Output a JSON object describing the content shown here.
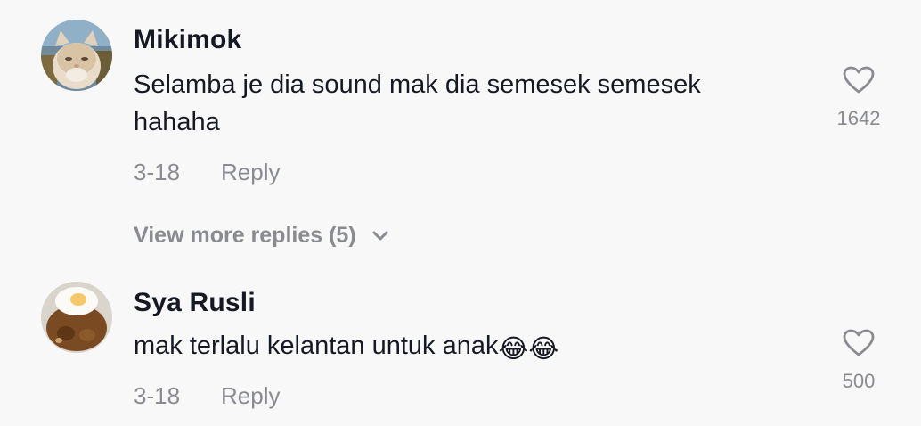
{
  "comments": [
    {
      "username": "Mikimok",
      "text": "Selamba je dia sound mak dia semesek semesek hahaha",
      "date": "3-18",
      "reply_label": "Reply",
      "likes": "1642",
      "avatar_icon": "cat-avatar"
    },
    {
      "username": "Sya Rusli",
      "text": "mak terlalu kelantan untuk anak",
      "emojis": "😂😂",
      "date": "3-18",
      "reply_label": "Reply",
      "likes": "500",
      "avatar_icon": "food-avatar"
    }
  ],
  "view_more": {
    "label": "View more replies (5)",
    "icon": "chevron-down-icon"
  },
  "colors": {
    "background": "#f8f8f8",
    "text": "#161823",
    "muted": "#8a8b91"
  }
}
